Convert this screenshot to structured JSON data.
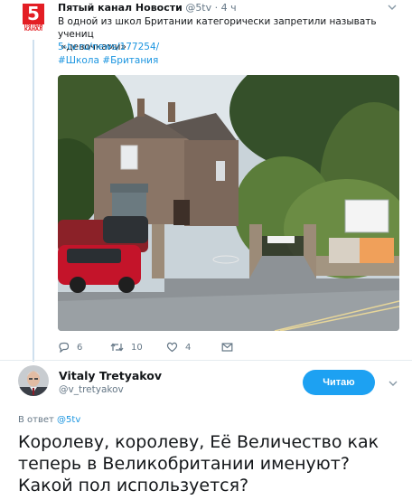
{
  "tweet1": {
    "author_name": "Пятый канал Новости",
    "handle": "@5tv",
    "time": "· 4 ч",
    "text_line1": "В одной из школ Британии категорически запретили называть учениц",
    "text_line2": "«девочками»",
    "link": "5-tv.ru/news/177254/",
    "hashtags": "#Школа #Британия",
    "avatar_label": "5",
    "avatar_sublabel": "ПЯТЫЙ\nКАНАЛ",
    "actions": {
      "replies": "6",
      "retweets": "10",
      "likes": "4"
    },
    "icons": [
      "reply-icon",
      "retweet-icon",
      "like-icon",
      "dm-icon",
      "chevron-down-icon"
    ]
  },
  "tweet2": {
    "author_name": "Vitaly Tretyakov",
    "handle": "@v_tretyakov",
    "follow_label": "Читаю",
    "reply_prefix": "В ответ",
    "reply_handle": "@5tv",
    "text": "Королеву, королеву, Её Величество как теперь в Великобритании именуют? Какой пол используется?"
  },
  "colors": {
    "accent": "#1da1f2",
    "link": "#1b95e0",
    "brand_red": "#e31e24",
    "muted": "#657786"
  }
}
